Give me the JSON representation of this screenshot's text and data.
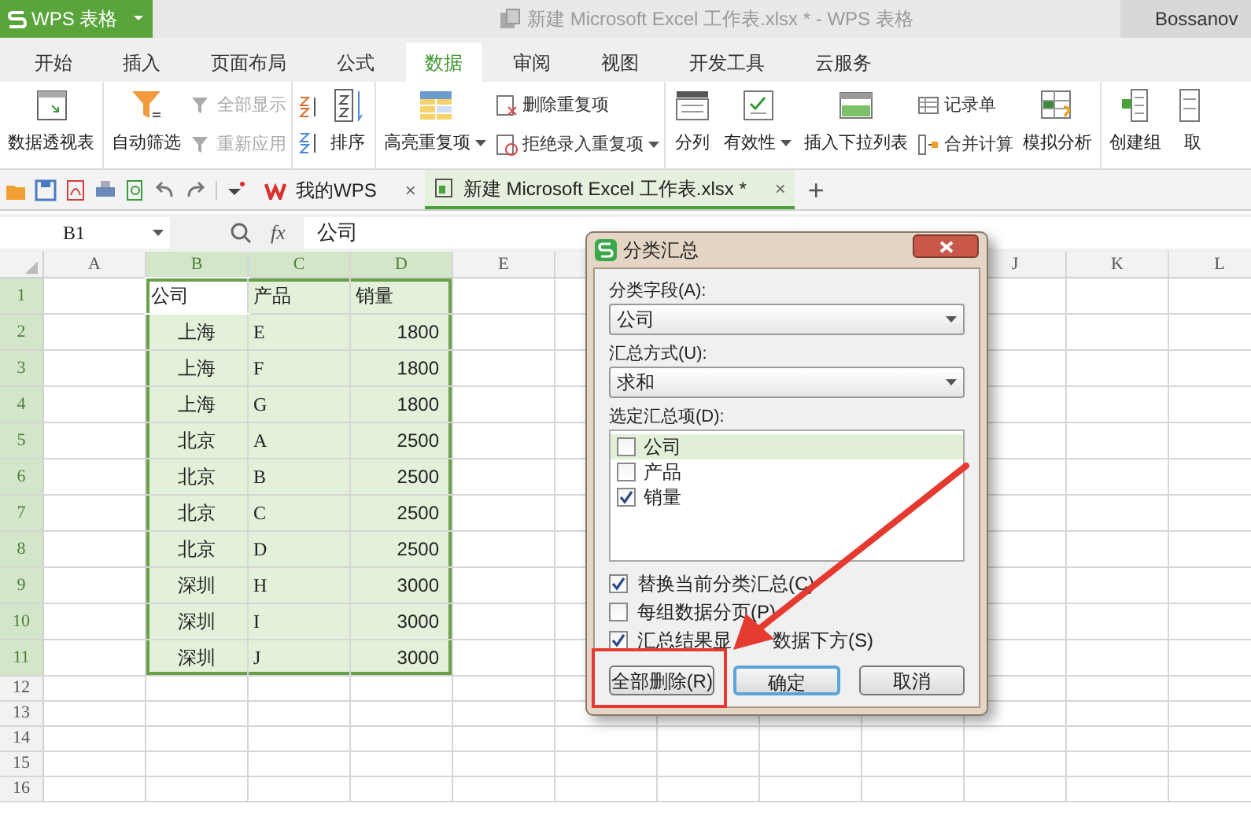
{
  "app_menu": {
    "label": "WPS 表格"
  },
  "window": {
    "title": "新建 Microsoft Excel 工作表.xlsx * - WPS 表格",
    "user": "Bossanov"
  },
  "ribbon_tabs": [
    {
      "label": "开始",
      "selected": false
    },
    {
      "label": "插入",
      "selected": false
    },
    {
      "label": "页面布局",
      "selected": false
    },
    {
      "label": "公式",
      "selected": false
    },
    {
      "label": "数据",
      "selected": true
    },
    {
      "label": "审阅",
      "selected": false
    },
    {
      "label": "视图",
      "selected": false
    },
    {
      "label": "开发工具",
      "selected": false
    },
    {
      "label": "云服务",
      "selected": false
    }
  ],
  "ribbon_groups": [
    {
      "items": [
        {
          "kind": "large",
          "label": "数据透视表",
          "dropdown": false
        }
      ]
    },
    {
      "items": [
        {
          "kind": "large",
          "label": "自动筛选",
          "dropdown": false
        },
        {
          "kind": "stack",
          "items": [
            {
              "label": "全部显示",
              "disabled": true,
              "dropdown": false
            },
            {
              "label": "重新应用",
              "disabled": true,
              "dropdown": false
            }
          ]
        }
      ]
    },
    {
      "items": [
        {
          "kind": "icon_stack"
        },
        {
          "kind": "large",
          "label": "排序",
          "dropdown": false
        }
      ]
    },
    {
      "items": [
        {
          "kind": "large",
          "label": "高亮重复项",
          "dropdown": true
        },
        {
          "kind": "stack",
          "items": [
            {
              "label": "删除重复项",
              "disabled": false,
              "dropdown": false
            },
            {
              "label": "拒绝录入重复项",
              "disabled": false,
              "dropdown": true
            }
          ]
        }
      ]
    },
    {
      "items": [
        {
          "kind": "large",
          "label": "分列",
          "dropdown": false
        },
        {
          "kind": "large",
          "label": "有效性",
          "dropdown": true
        },
        {
          "kind": "large",
          "label": "插入下拉列表",
          "dropdown": false
        },
        {
          "kind": "stack",
          "items": [
            {
              "label": "记录单",
              "disabled": false,
              "dropdown": false
            },
            {
              "label": "合并计算",
              "disabled": false,
              "dropdown": false
            }
          ]
        },
        {
          "kind": "large",
          "label": "模拟分析",
          "dropdown": false
        }
      ]
    },
    {
      "items": [
        {
          "kind": "large",
          "label": "创建组",
          "dropdown": false
        },
        {
          "kind": "large",
          "label": "取",
          "dropdown": false
        }
      ]
    }
  ],
  "doc_tabs": [
    {
      "label": "我的WPS",
      "selected": false,
      "close": "×"
    },
    {
      "label": "新建 Microsoft Excel 工作表.xlsx *",
      "selected": true,
      "close": "×"
    }
  ],
  "new_tab": "+",
  "formula_bar": {
    "name_box": "B1",
    "fx": "fx",
    "formula": "公司"
  },
  "column_headers": [
    {
      "label": "A",
      "selected": false
    },
    {
      "label": "B",
      "selected": true
    },
    {
      "label": "C",
      "selected": true
    },
    {
      "label": "D",
      "selected": true
    },
    {
      "label": "E",
      "selected": false
    },
    {
      "label": "J",
      "selected": false
    },
    {
      "label": "K",
      "selected": false
    },
    {
      "label": "L",
      "selected": false
    }
  ],
  "rows": [
    {
      "label": "1",
      "selected": true,
      "cells": [
        {
          "text": "公司",
          "active": true
        },
        {
          "text": "产品",
          "active": false
        },
        {
          "text": "销量",
          "active": false
        }
      ]
    },
    {
      "label": "2",
      "selected": true,
      "cells": [
        {
          "text": "上海",
          "active": false
        },
        {
          "text": "E",
          "active": false
        },
        {
          "text": "1800",
          "active": false
        }
      ]
    },
    {
      "label": "3",
      "selected": true,
      "cells": [
        {
          "text": "上海",
          "active": false
        },
        {
          "text": "F",
          "active": false
        },
        {
          "text": "1800",
          "active": false
        }
      ]
    },
    {
      "label": "4",
      "selected": true,
      "cells": [
        {
          "text": "上海",
          "active": false
        },
        {
          "text": "G",
          "active": false
        },
        {
          "text": "1800",
          "active": false
        }
      ]
    },
    {
      "label": "5",
      "selected": true,
      "cells": [
        {
          "text": "北京",
          "active": false
        },
        {
          "text": "A",
          "active": false
        },
        {
          "text": "2500",
          "active": false
        }
      ]
    },
    {
      "label": "6",
      "selected": true,
      "cells": [
        {
          "text": "北京",
          "active": false
        },
        {
          "text": "B",
          "active": false
        },
        {
          "text": "2500",
          "active": false
        }
      ]
    },
    {
      "label": "7",
      "selected": true,
      "cells": [
        {
          "text": "北京",
          "active": false
        },
        {
          "text": "C",
          "active": false
        },
        {
          "text": "2500",
          "active": false
        }
      ]
    },
    {
      "label": "8",
      "selected": true,
      "cells": [
        {
          "text": "北京",
          "active": false
        },
        {
          "text": "D",
          "active": false
        },
        {
          "text": "2500",
          "active": false
        }
      ]
    },
    {
      "label": "9",
      "selected": true,
      "cells": [
        {
          "text": "深圳",
          "active": false
        },
        {
          "text": "H",
          "active": false
        },
        {
          "text": "3000",
          "active": false
        }
      ]
    },
    {
      "label": "10",
      "selected": true,
      "cells": [
        {
          "text": "深圳",
          "active": false
        },
        {
          "text": "I",
          "active": false
        },
        {
          "text": "3000",
          "active": false
        }
      ]
    },
    {
      "label": "11",
      "selected": true,
      "cells": [
        {
          "text": "深圳",
          "active": false
        },
        {
          "text": "J",
          "active": false
        },
        {
          "text": "3000",
          "active": false
        }
      ]
    },
    {
      "label": "12",
      "selected": false
    },
    {
      "label": "13",
      "selected": false
    },
    {
      "label": "14",
      "selected": false
    },
    {
      "label": "15",
      "selected": false
    },
    {
      "label": "16",
      "selected": false
    }
  ],
  "dialog": {
    "title": "分类汇总",
    "fields": [
      {
        "label": "分类字段(A):",
        "value": "公司"
      },
      {
        "label": "汇总方式(U):",
        "value": "求和"
      }
    ],
    "list_label": "选定汇总项(D):",
    "list_items": [
      {
        "label": "公司",
        "checked": false,
        "selected": true
      },
      {
        "label": "产品",
        "checked": false,
        "selected": false
      },
      {
        "label": "销量",
        "checked": true,
        "selected": false
      }
    ],
    "options": [
      {
        "label": "替换当前分类汇总(C)",
        "checked": true
      },
      {
        "label": "每组数据分页(P)",
        "checked": false
      },
      {
        "label": "汇总结果显",
        "label_tail": "数据下方(S)",
        "checked": true
      }
    ],
    "buttons": [
      {
        "label": "全部删除(R)",
        "default": false
      },
      {
        "label": "确定",
        "default": true
      },
      {
        "label": "取消",
        "default": false
      }
    ]
  }
}
